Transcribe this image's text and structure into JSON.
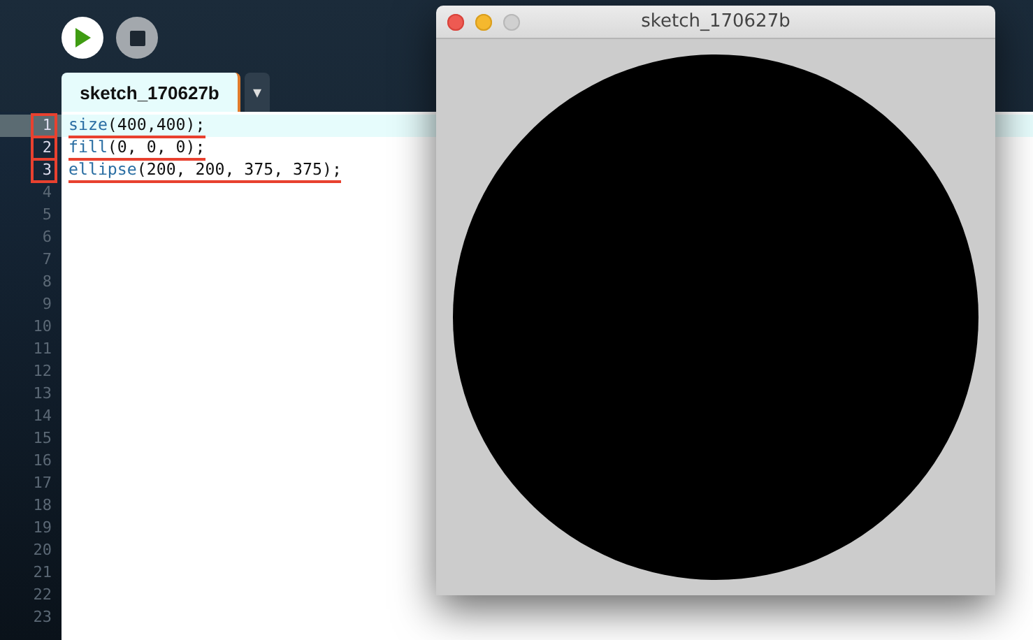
{
  "toolbar": {
    "buttons": [
      {
        "kind": "run"
      },
      {
        "kind": "stop"
      }
    ]
  },
  "tabs": [
    {
      "label": "sketch_170627b",
      "selected": true,
      "menu": "▾"
    }
  ],
  "editor": {
    "lines": [
      {
        "number": "1",
        "current": true,
        "highlighted": true,
        "tokens": [
          {
            "text": "size",
            "kind": "function"
          },
          {
            "text": "(400,400);",
            "kind": "plain"
          }
        ]
      },
      {
        "number": "2",
        "current": false,
        "highlighted": true,
        "tokens": [
          {
            "text": "fill",
            "kind": "function"
          },
          {
            "text": "(0, 0, 0);",
            "kind": "plain"
          }
        ]
      },
      {
        "number": "3",
        "current": false,
        "highlighted": true,
        "tokens": [
          {
            "text": "ellipse",
            "kind": "function"
          },
          {
            "text": "(200, 200, 375, 375);",
            "kind": "plain"
          }
        ]
      },
      {
        "number": "4",
        "current": false,
        "highlighted": false
      },
      {
        "number": "5",
        "current": false,
        "highlighted": false
      },
      {
        "number": "6",
        "current": false,
        "highlighted": false
      },
      {
        "number": "7",
        "current": false,
        "highlighted": false
      },
      {
        "number": "8",
        "current": false,
        "highlighted": false
      },
      {
        "number": "9",
        "current": false,
        "highlighted": false
      },
      {
        "number": "10",
        "current": false,
        "highlighted": false
      },
      {
        "number": "11",
        "current": false,
        "highlighted": false
      },
      {
        "number": "12",
        "current": false,
        "highlighted": false
      },
      {
        "number": "13",
        "current": false,
        "highlighted": false
      },
      {
        "number": "14",
        "current": false,
        "highlighted": false
      },
      {
        "number": "15",
        "current": false,
        "highlighted": false
      },
      {
        "number": "16",
        "current": false,
        "highlighted": false
      },
      {
        "number": "17",
        "current": false,
        "highlighted": false
      },
      {
        "number": "18",
        "current": false,
        "highlighted": false
      },
      {
        "number": "19",
        "current": false,
        "highlighted": false
      },
      {
        "number": "20",
        "current": false,
        "highlighted": false
      },
      {
        "number": "21",
        "current": false,
        "highlighted": false
      },
      {
        "number": "22",
        "current": false,
        "highlighted": false
      },
      {
        "number": "23",
        "current": false,
        "highlighted": false
      }
    ]
  },
  "sketch_window": {
    "title": "sketch_170627b",
    "window_buttons": [
      {
        "kind": "close",
        "color": "#ee5a52"
      },
      {
        "kind": "minimize",
        "color": "#f5b82e"
      },
      {
        "kind": "zoom",
        "color": "#d0d0d0"
      }
    ],
    "shape": {
      "kind": "circle"
    }
  }
}
